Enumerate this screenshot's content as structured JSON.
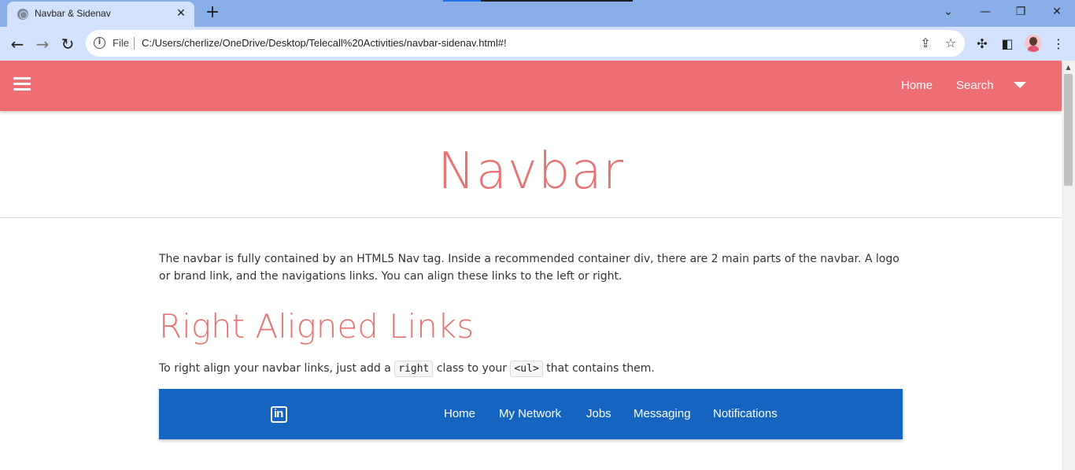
{
  "browser": {
    "tab_title": "Navbar & Sidenav",
    "tab_close": "✕",
    "new_tab": "+",
    "url_scheme_label": "File",
    "url": "C:/Users/cherlize/OneDrive/Desktop/Telecall%20Activities/navbar-sidenav.html#!",
    "icons": {
      "back": "arrow-left-icon",
      "forward": "arrow-right-icon",
      "reload": "reload-icon",
      "info": "info-icon",
      "share": "share-icon",
      "bookmark": "star-icon",
      "extensions": "puzzle-icon",
      "sidepanel": "side-panel-icon",
      "menu": "kebab-menu-icon"
    }
  },
  "navbar": {
    "links": [
      "Home",
      "Search"
    ],
    "background": "#ee6e73"
  },
  "page": {
    "title": "Navbar",
    "intro": "The navbar is fully contained by an HTML5 Nav tag. Inside a recommended container div, there are 2 main parts of the navbar. A logo or brand link, and the navigations links. You can align these links to the left or right.",
    "section_title": "Right Aligned Links",
    "section_text_before": "To right align your navbar links, just add a ",
    "code1": "right",
    "section_text_middle": " class to your ",
    "code2": "<ul>",
    "section_text_after": " that contains them.",
    "accent": "#e57373"
  },
  "demo_nav": {
    "logo": "in",
    "links": [
      "Home",
      "My Network",
      "Jobs",
      "Messaging",
      "Notifications"
    ],
    "background": "#1565c0"
  }
}
